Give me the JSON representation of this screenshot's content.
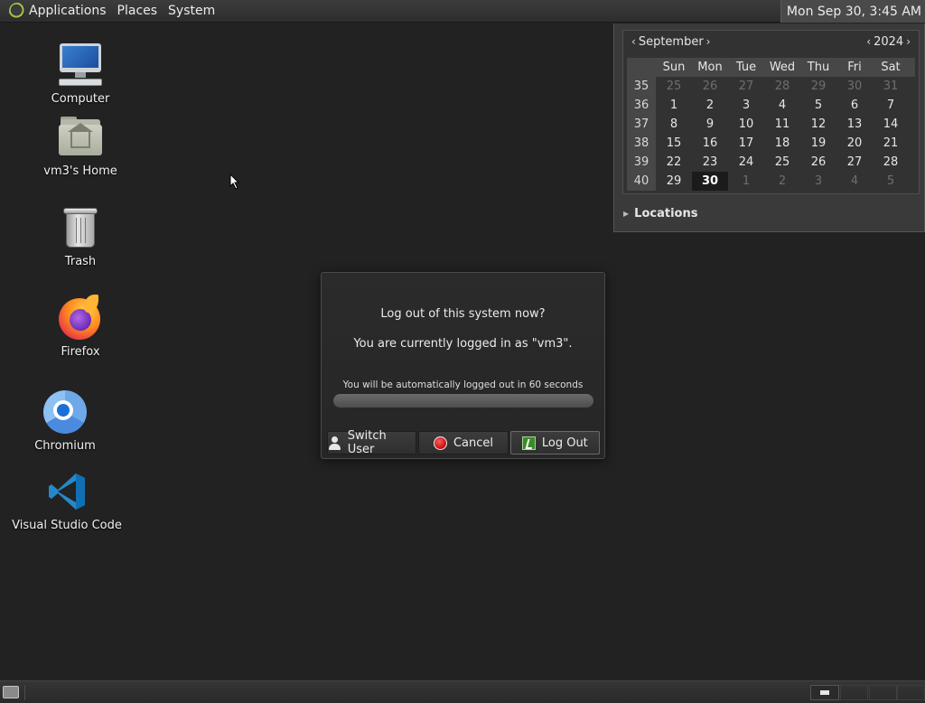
{
  "top_panel": {
    "menus": [
      "Applications",
      "Places",
      "System"
    ],
    "clock": "Mon Sep 30,  3:45 AM"
  },
  "desktop_icons": [
    {
      "label": "Computer",
      "icon": "computer-icon"
    },
    {
      "label": "vm3's Home",
      "icon": "home-folder-icon"
    },
    {
      "label": "Trash",
      "icon": "trash-icon"
    },
    {
      "label": "Firefox",
      "icon": "firefox-icon"
    },
    {
      "label": "Chromium",
      "icon": "chromium-icon"
    },
    {
      "label": "Visual Studio Code",
      "icon": "vscode-icon"
    }
  ],
  "calendar": {
    "month": "September",
    "year": "2024",
    "weekdays": [
      "Sun",
      "Mon",
      "Tue",
      "Wed",
      "Thu",
      "Fri",
      "Sat"
    ],
    "weeks": [
      {
        "num": "35",
        "days": [
          "25",
          "26",
          "27",
          "28",
          "29",
          "30",
          "31"
        ],
        "dim": [
          true,
          true,
          true,
          true,
          true,
          true,
          true
        ]
      },
      {
        "num": "36",
        "days": [
          "1",
          "2",
          "3",
          "4",
          "5",
          "6",
          "7"
        ],
        "dim": [
          false,
          false,
          false,
          false,
          false,
          false,
          false
        ]
      },
      {
        "num": "37",
        "days": [
          "8",
          "9",
          "10",
          "11",
          "12",
          "13",
          "14"
        ],
        "dim": [
          false,
          false,
          false,
          false,
          false,
          false,
          false
        ]
      },
      {
        "num": "38",
        "days": [
          "15",
          "16",
          "17",
          "18",
          "19",
          "20",
          "21"
        ],
        "dim": [
          false,
          false,
          false,
          false,
          false,
          false,
          false
        ]
      },
      {
        "num": "39",
        "days": [
          "22",
          "23",
          "24",
          "25",
          "26",
          "27",
          "28"
        ],
        "dim": [
          false,
          false,
          false,
          false,
          false,
          false,
          false
        ]
      },
      {
        "num": "40",
        "days": [
          "29",
          "30",
          "1",
          "2",
          "3",
          "4",
          "5"
        ],
        "dim": [
          false,
          false,
          true,
          true,
          true,
          true,
          true
        ]
      }
    ],
    "today": "30",
    "locations_label": "Locations"
  },
  "logout_dialog": {
    "title": "Log out of this system now?",
    "user_line": "You are currently logged in as \"vm3\".",
    "countdown": "You will be automatically logged out in 60 seconds",
    "progress": 1.0,
    "buttons": {
      "switch_user": "Switch User",
      "cancel": "Cancel",
      "log_out": "Log Out"
    }
  }
}
